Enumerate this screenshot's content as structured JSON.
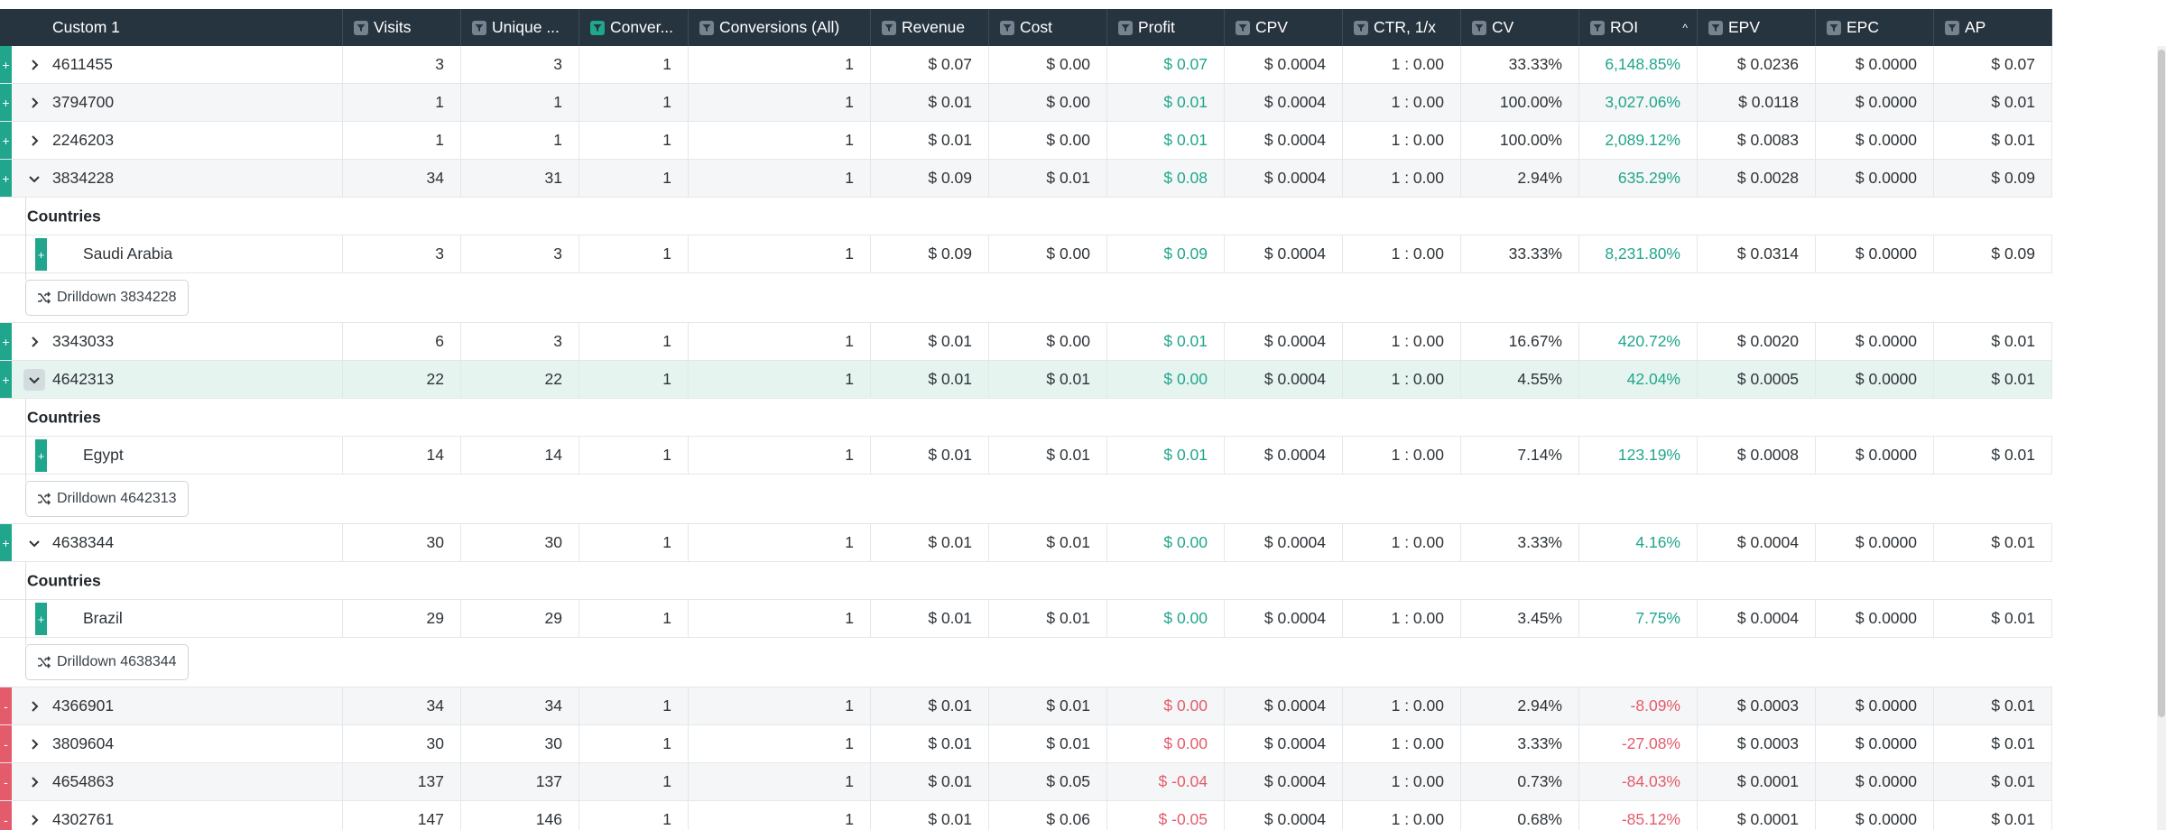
{
  "columns": [
    {
      "label": "Custom 1",
      "filter": false
    },
    {
      "label": "Visits",
      "filter": true
    },
    {
      "label": "Unique ...",
      "filter": true
    },
    {
      "label": "Conver...",
      "filter": true,
      "active": true
    },
    {
      "label": "Conversions (All)",
      "filter": true
    },
    {
      "label": "Revenue",
      "filter": true
    },
    {
      "label": "Cost",
      "filter": true
    },
    {
      "label": "Profit",
      "filter": true
    },
    {
      "label": "CPV",
      "filter": true
    },
    {
      "label": "CTR, 1/x",
      "filter": true
    },
    {
      "label": "CV",
      "filter": true
    },
    {
      "label": "ROI",
      "filter": true,
      "sort": "^"
    },
    {
      "label": "EPV",
      "filter": true
    },
    {
      "label": "EPC",
      "filter": true
    },
    {
      "label": "AP",
      "filter": true
    }
  ],
  "rows": [
    {
      "marker": "+",
      "expanded": false,
      "values": [
        "4611455",
        "3",
        "3",
        "1",
        "1",
        "$ 0.07",
        "$ 0.00",
        "$ 0.07",
        "$ 0.0004",
        "1 : 0.00",
        "33.33%",
        "6,148.85%",
        "$ 0.0236",
        "$ 0.0000",
        "$ 0.07"
      ]
    },
    {
      "marker": "+",
      "expanded": false,
      "values": [
        "3794700",
        "1",
        "1",
        "1",
        "1",
        "$ 0.01",
        "$ 0.00",
        "$ 0.01",
        "$ 0.0004",
        "1 : 0.00",
        "100.00%",
        "3,027.06%",
        "$ 0.0118",
        "$ 0.0000",
        "$ 0.01"
      ]
    },
    {
      "marker": "+",
      "expanded": false,
      "values": [
        "2246203",
        "1",
        "1",
        "1",
        "1",
        "$ 0.01",
        "$ 0.00",
        "$ 0.01",
        "$ 0.0004",
        "1 : 0.00",
        "100.00%",
        "2,089.12%",
        "$ 0.0083",
        "$ 0.0000",
        "$ 0.01"
      ]
    },
    {
      "marker": "+",
      "expanded": true,
      "values": [
        "3834228",
        "34",
        "31",
        "1",
        "1",
        "$ 0.09",
        "$ 0.01",
        "$ 0.08",
        "$ 0.0004",
        "1 : 0.00",
        "2.94%",
        "635.29%",
        "$ 0.0028",
        "$ 0.0000",
        "$ 0.09"
      ],
      "group_label": "Countries",
      "children": [
        {
          "marker": "+",
          "values": [
            "Saudi Arabia",
            "3",
            "3",
            "1",
            "1",
            "$ 0.09",
            "$ 0.00",
            "$ 0.09",
            "$ 0.0004",
            "1 : 0.00",
            "33.33%",
            "8,231.80%",
            "$ 0.0314",
            "$ 0.0000",
            "$ 0.09"
          ]
        }
      ],
      "drill_label": "Drilldown 3834228"
    },
    {
      "marker": "+",
      "expanded": false,
      "values": [
        "3343033",
        "6",
        "3",
        "1",
        "1",
        "$ 0.01",
        "$ 0.00",
        "$ 0.01",
        "$ 0.0004",
        "1 : 0.00",
        "16.67%",
        "420.72%",
        "$ 0.0020",
        "$ 0.0000",
        "$ 0.01"
      ]
    },
    {
      "marker": "+",
      "expanded": true,
      "highlighted": true,
      "values": [
        "4642313",
        "22",
        "22",
        "1",
        "1",
        "$ 0.01",
        "$ 0.01",
        "$ 0.00",
        "$ 0.0004",
        "1 : 0.00",
        "4.55%",
        "42.04%",
        "$ 0.0005",
        "$ 0.0000",
        "$ 0.01"
      ],
      "group_label": "Countries",
      "children": [
        {
          "marker": "+",
          "values": [
            "Egypt",
            "14",
            "14",
            "1",
            "1",
            "$ 0.01",
            "$ 0.01",
            "$ 0.01",
            "$ 0.0004",
            "1 : 0.00",
            "7.14%",
            "123.19%",
            "$ 0.0008",
            "$ 0.0000",
            "$ 0.01"
          ]
        }
      ],
      "drill_label": "Drilldown 4642313"
    },
    {
      "marker": "+",
      "expanded": true,
      "values": [
        "4638344",
        "30",
        "30",
        "1",
        "1",
        "$ 0.01",
        "$ 0.01",
        "$ 0.00",
        "$ 0.0004",
        "1 : 0.00",
        "3.33%",
        "4.16%",
        "$ 0.0004",
        "$ 0.0000",
        "$ 0.01"
      ],
      "group_label": "Countries",
      "children": [
        {
          "marker": "+",
          "values": [
            "Brazil",
            "29",
            "29",
            "1",
            "1",
            "$ 0.01",
            "$ 0.01",
            "$ 0.00",
            "$ 0.0004",
            "1 : 0.00",
            "3.45%",
            "7.75%",
            "$ 0.0004",
            "$ 0.0000",
            "$ 0.01"
          ]
        }
      ],
      "drill_label": "Drilldown 4638344"
    },
    {
      "marker": "-",
      "expanded": false,
      "values": [
        "4366901",
        "34",
        "34",
        "1",
        "1",
        "$ 0.01",
        "$ 0.01",
        "$ 0.00",
        "$ 0.0004",
        "1 : 0.00",
        "2.94%",
        "-8.09%",
        "$ 0.0003",
        "$ 0.0000",
        "$ 0.01"
      ]
    },
    {
      "marker": "-",
      "expanded": false,
      "values": [
        "3809604",
        "30",
        "30",
        "1",
        "1",
        "$ 0.01",
        "$ 0.01",
        "$ 0.00",
        "$ 0.0004",
        "1 : 0.00",
        "3.33%",
        "-27.08%",
        "$ 0.0003",
        "$ 0.0000",
        "$ 0.01"
      ]
    },
    {
      "marker": "-",
      "expanded": false,
      "values": [
        "4654863",
        "137",
        "137",
        "1",
        "1",
        "$ 0.01",
        "$ 0.05",
        "$ -0.04",
        "$ 0.0004",
        "1 : 0.00",
        "0.73%",
        "-84.03%",
        "$ 0.0001",
        "$ 0.0000",
        "$ 0.01"
      ]
    },
    {
      "marker": "-",
      "expanded": false,
      "values": [
        "4302761",
        "147",
        "146",
        "1",
        "1",
        "$ 0.01",
        "$ 0.06",
        "$ -0.05",
        "$ 0.0004",
        "1 : 0.00",
        "0.68%",
        "-85.12%",
        "$ 0.0001",
        "$ 0.0000",
        "$ 0.01"
      ]
    }
  ],
  "colors": {
    "positive": "#20a68c",
    "negative": "#e45b6b",
    "header_bg": "#263440"
  }
}
